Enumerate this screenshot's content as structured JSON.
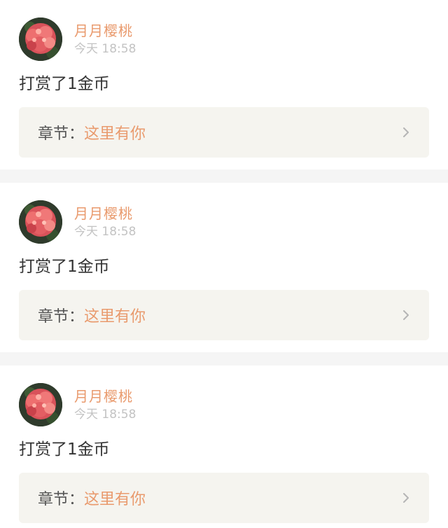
{
  "posts": [
    {
      "user": "月月樱桃",
      "time": "今天 18:58",
      "action": "打赏了1金币",
      "chapter_label": "章节：",
      "chapter_title": "这里有你"
    },
    {
      "user": "月月樱桃",
      "time": "今天 18:58",
      "action": "打赏了1金币",
      "chapter_label": "章节：",
      "chapter_title": "这里有你"
    },
    {
      "user": "月月樱桃",
      "time": "今天 18:58",
      "action": "打赏了1金币",
      "chapter_label": "章节：",
      "chapter_title": "这里有你"
    }
  ],
  "colors": {
    "accent": "#e99a6d",
    "muted": "#c3c3c3",
    "text": "#333333",
    "chapter_bg": "#f5f4ef",
    "separator": "#f5f5f5"
  },
  "icons": {
    "avatar": "flower-avatar",
    "chevron": "chevron-right-icon"
  }
}
